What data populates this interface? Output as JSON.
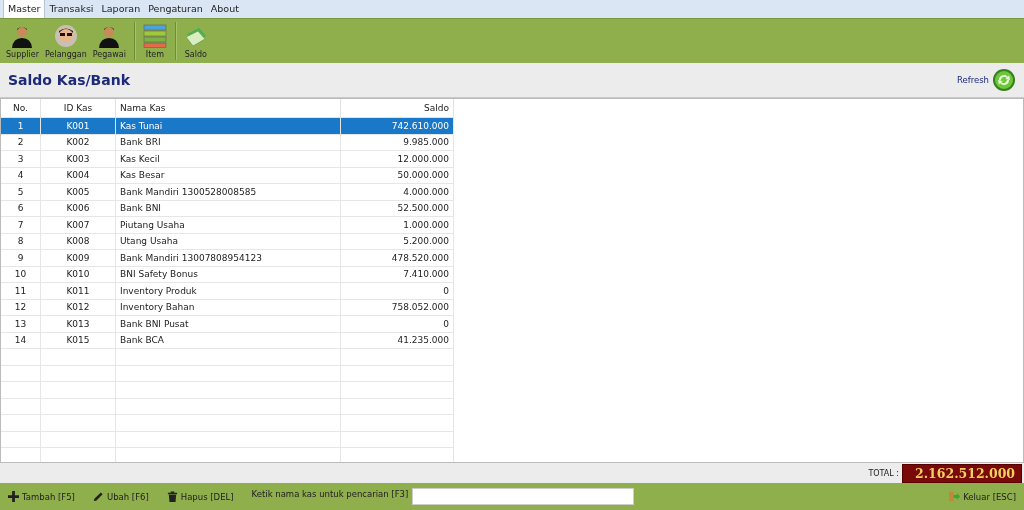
{
  "tabs": [
    {
      "label": "Master",
      "selected": true
    },
    {
      "label": "Transaksi",
      "selected": false
    },
    {
      "label": "Laporan",
      "selected": false
    },
    {
      "label": "Pengaturan",
      "selected": false
    },
    {
      "label": "About",
      "selected": false
    }
  ],
  "toolbar": {
    "groups": [
      [
        {
          "label": "Supplier",
          "kind": "person"
        },
        {
          "label": "Pelanggan",
          "kind": "glasses"
        },
        {
          "label": "Pegawai",
          "kind": "person"
        }
      ],
      [
        {
          "label": "Item",
          "kind": "stack"
        }
      ],
      [
        {
          "label": "Saldo",
          "kind": "money"
        }
      ]
    ]
  },
  "page": {
    "title": "Saldo Kas/Bank",
    "refresh": "Refresh"
  },
  "table": {
    "columns": [
      "No.",
      "ID Kas",
      "Nama Kas",
      "Saldo"
    ],
    "rows": [
      {
        "no": "1",
        "id": "K001",
        "name": "Kas Tunai",
        "saldo": "742.610.000",
        "selected": true
      },
      {
        "no": "2",
        "id": "K002",
        "name": "Bank BRI",
        "saldo": "9.985.000",
        "selected": false
      },
      {
        "no": "3",
        "id": "K003",
        "name": "Kas Kecil",
        "saldo": "12.000.000",
        "selected": false
      },
      {
        "no": "4",
        "id": "K004",
        "name": "Kas Besar",
        "saldo": "50.000.000",
        "selected": false
      },
      {
        "no": "5",
        "id": "K005",
        "name": "Bank Mandiri 1300528008585",
        "saldo": "4.000.000",
        "selected": false
      },
      {
        "no": "6",
        "id": "K006",
        "name": "Bank BNI",
        "saldo": "52.500.000",
        "selected": false
      },
      {
        "no": "7",
        "id": "K007",
        "name": "Piutang Usaha",
        "saldo": "1.000.000",
        "selected": false
      },
      {
        "no": "8",
        "id": "K008",
        "name": "Utang Usaha",
        "saldo": "5.200.000",
        "selected": false
      },
      {
        "no": "9",
        "id": "K009",
        "name": "Bank Mandiri 13007808954123",
        "saldo": "478.520.000",
        "selected": false
      },
      {
        "no": "10",
        "id": "K010",
        "name": "BNI Safety Bonus",
        "saldo": "7.410.000",
        "selected": false
      },
      {
        "no": "11",
        "id": "K011",
        "name": "Inventory Produk",
        "saldo": "0",
        "selected": false
      },
      {
        "no": "12",
        "id": "K012",
        "name": "Inventory Bahan",
        "saldo": "758.052.000",
        "selected": false
      },
      {
        "no": "13",
        "id": "K013",
        "name": "Bank BNI Pusat",
        "saldo": "0",
        "selected": false
      },
      {
        "no": "14",
        "id": "K015",
        "name": "Bank BCA",
        "saldo": "41.235.000",
        "selected": false
      }
    ]
  },
  "total": {
    "label": "TOTAL :",
    "value": "2.162.512.000"
  },
  "bottom": {
    "actions": [
      {
        "label": "Tambah [F5]",
        "kind": "add"
      },
      {
        "label": "Ubah [F6]",
        "kind": "edit"
      },
      {
        "label": "Hapus [DEL]",
        "kind": "delete"
      }
    ],
    "search_label": "Ketik nama kas untuk pencarian [F3]",
    "exit": "Keluar [ESC]"
  }
}
